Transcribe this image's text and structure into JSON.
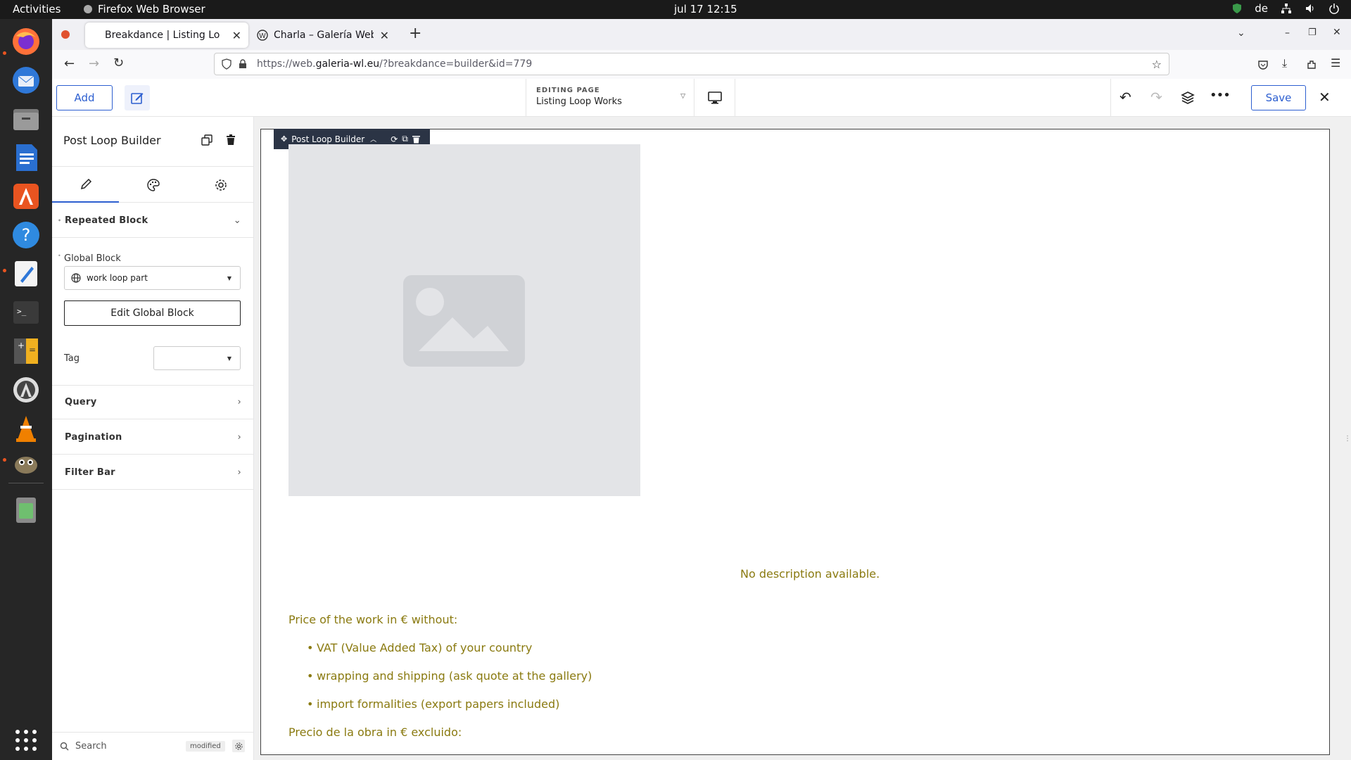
{
  "system_bar": {
    "activities": "Activities",
    "app_name": "Firefox Web Browser",
    "clock": "jul 17  12:15",
    "language": "de"
  },
  "browser": {
    "tabs": [
      {
        "title": "Breakdance | Listing Loop Works",
        "active": true
      },
      {
        "title": "Charla – Galería Weber-Lutgen",
        "active": false
      }
    ],
    "url": {
      "prefix": "https://web.",
      "host": "galeria-wl.eu",
      "path": "/?breakdance=builder&id=779"
    }
  },
  "builder": {
    "add_label": "Add",
    "editing_label": "EDITING PAGE",
    "editing_value": "Listing Loop Works",
    "save_label": "Save"
  },
  "sidebar": {
    "title": "Post Loop Builder",
    "sections": {
      "repeated_block": "Repeated Block",
      "query": "Query",
      "pagination": "Pagination",
      "filter_bar": "Filter Bar"
    },
    "global_block_label": "Global Block",
    "global_block_value": "work loop part",
    "edit_global_block": "Edit Global Block",
    "tag_label": "Tag",
    "tag_value": "",
    "search_placeholder": "Search",
    "modified_badge": "modified"
  },
  "canvas": {
    "element_label": "Post Loop Builder",
    "no_description": "No description available.",
    "price_heading": "Price of the work in € without:",
    "price_items": [
      "VAT (Value Added Tax) of your country",
      "wrapping and shipping (ask quote at the gallery)",
      "import formalities (export papers included)"
    ],
    "precio_heading": "Precio de la obra in € excluido:"
  },
  "colors": {
    "accent": "#2d5fd0",
    "content_text": "#8a7a10"
  }
}
